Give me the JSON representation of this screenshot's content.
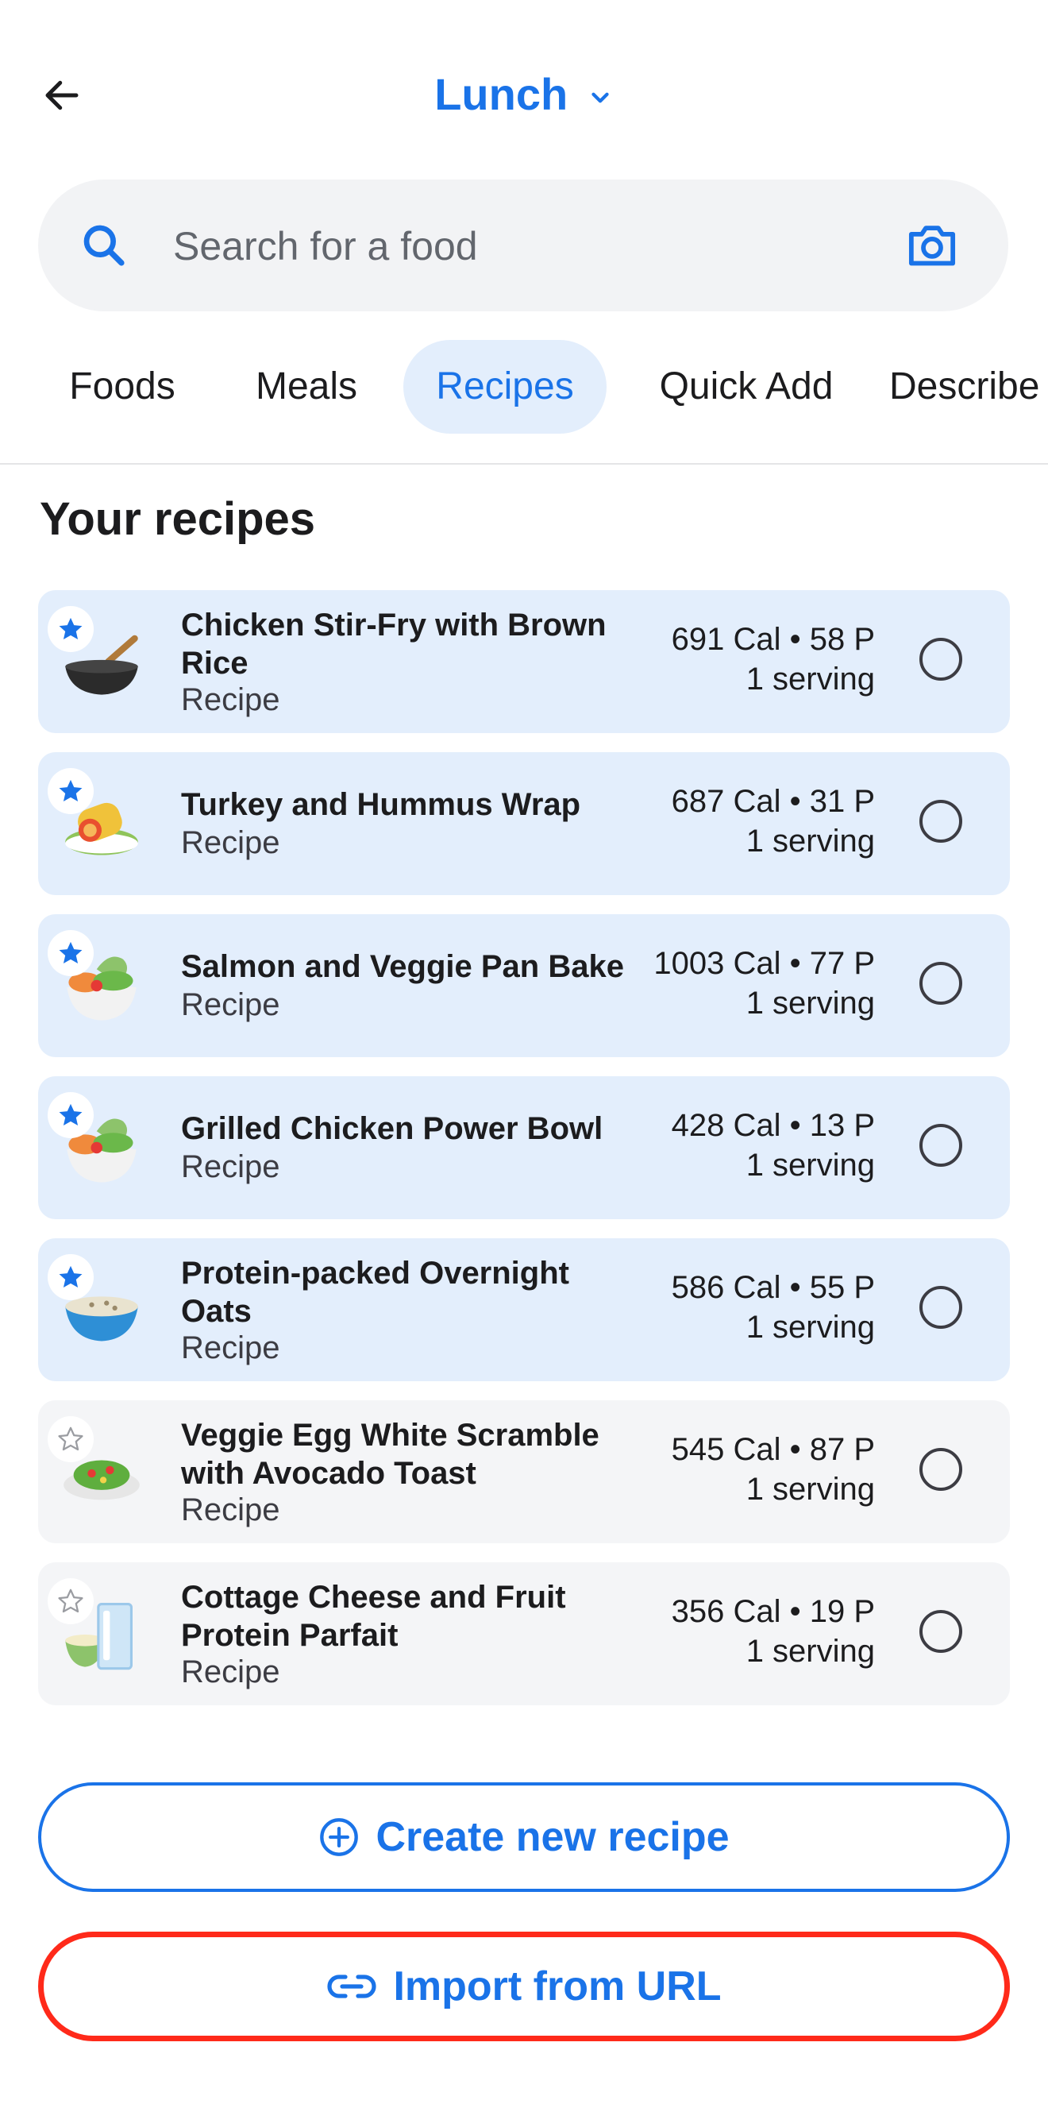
{
  "header": {
    "title": "Lunch"
  },
  "search": {
    "placeholder": "Search for a food"
  },
  "tabs": [
    {
      "label": "Foods",
      "active": false
    },
    {
      "label": "Meals",
      "active": false
    },
    {
      "label": "Recipes",
      "active": true
    },
    {
      "label": "Quick Add",
      "active": false
    },
    {
      "label": "Describe",
      "active": false
    }
  ],
  "section_title": "Your recipes",
  "recipes": [
    {
      "name": "Chicken Stir-Fry with Brown Rice",
      "type": "Recipe",
      "calories": "691 Cal • 58 P",
      "serving": "1 serving",
      "favorite": true,
      "icon": "wok-icon"
    },
    {
      "name": "Turkey and Hummus Wrap",
      "type": "Recipe",
      "calories": "687 Cal • 31 P",
      "serving": "1 serving",
      "favorite": true,
      "icon": "wrap-icon"
    },
    {
      "name": "Salmon and Veggie Pan Bake",
      "type": "Recipe",
      "calories": "1003 Cal • 77 P",
      "serving": "1 serving",
      "favorite": true,
      "icon": "veggie-bowl-icon"
    },
    {
      "name": "Grilled Chicken Power Bowl",
      "type": "Recipe",
      "calories": "428 Cal • 13 P",
      "serving": "1 serving",
      "favorite": true,
      "icon": "veggie-bowl-icon"
    },
    {
      "name": "Protein-packed Overnight Oats",
      "type": "Recipe",
      "calories": "586 Cal • 55 P",
      "serving": "1 serving",
      "favorite": true,
      "icon": "oats-bowl-icon"
    },
    {
      "name": "Veggie Egg White Scramble with Avocado Toast",
      "type": "Recipe",
      "calories": "545 Cal • 87 P",
      "serving": "1 serving",
      "favorite": false,
      "icon": "salad-plate-icon"
    },
    {
      "name": "Cottage Cheese and Fruit Protein Parfait",
      "type": "Recipe",
      "calories": "356 Cal • 19 P",
      "serving": "1 serving",
      "favorite": false,
      "icon": "glass-bowl-icon"
    }
  ],
  "buttons": {
    "create": "Create new recipe",
    "import": "Import from URL"
  },
  "colors": {
    "accent": "#1a73e8",
    "favorite_bg": "#e3eefc",
    "plain_bg": "#f4f5f7",
    "highlight_border": "#ff2a1a"
  }
}
